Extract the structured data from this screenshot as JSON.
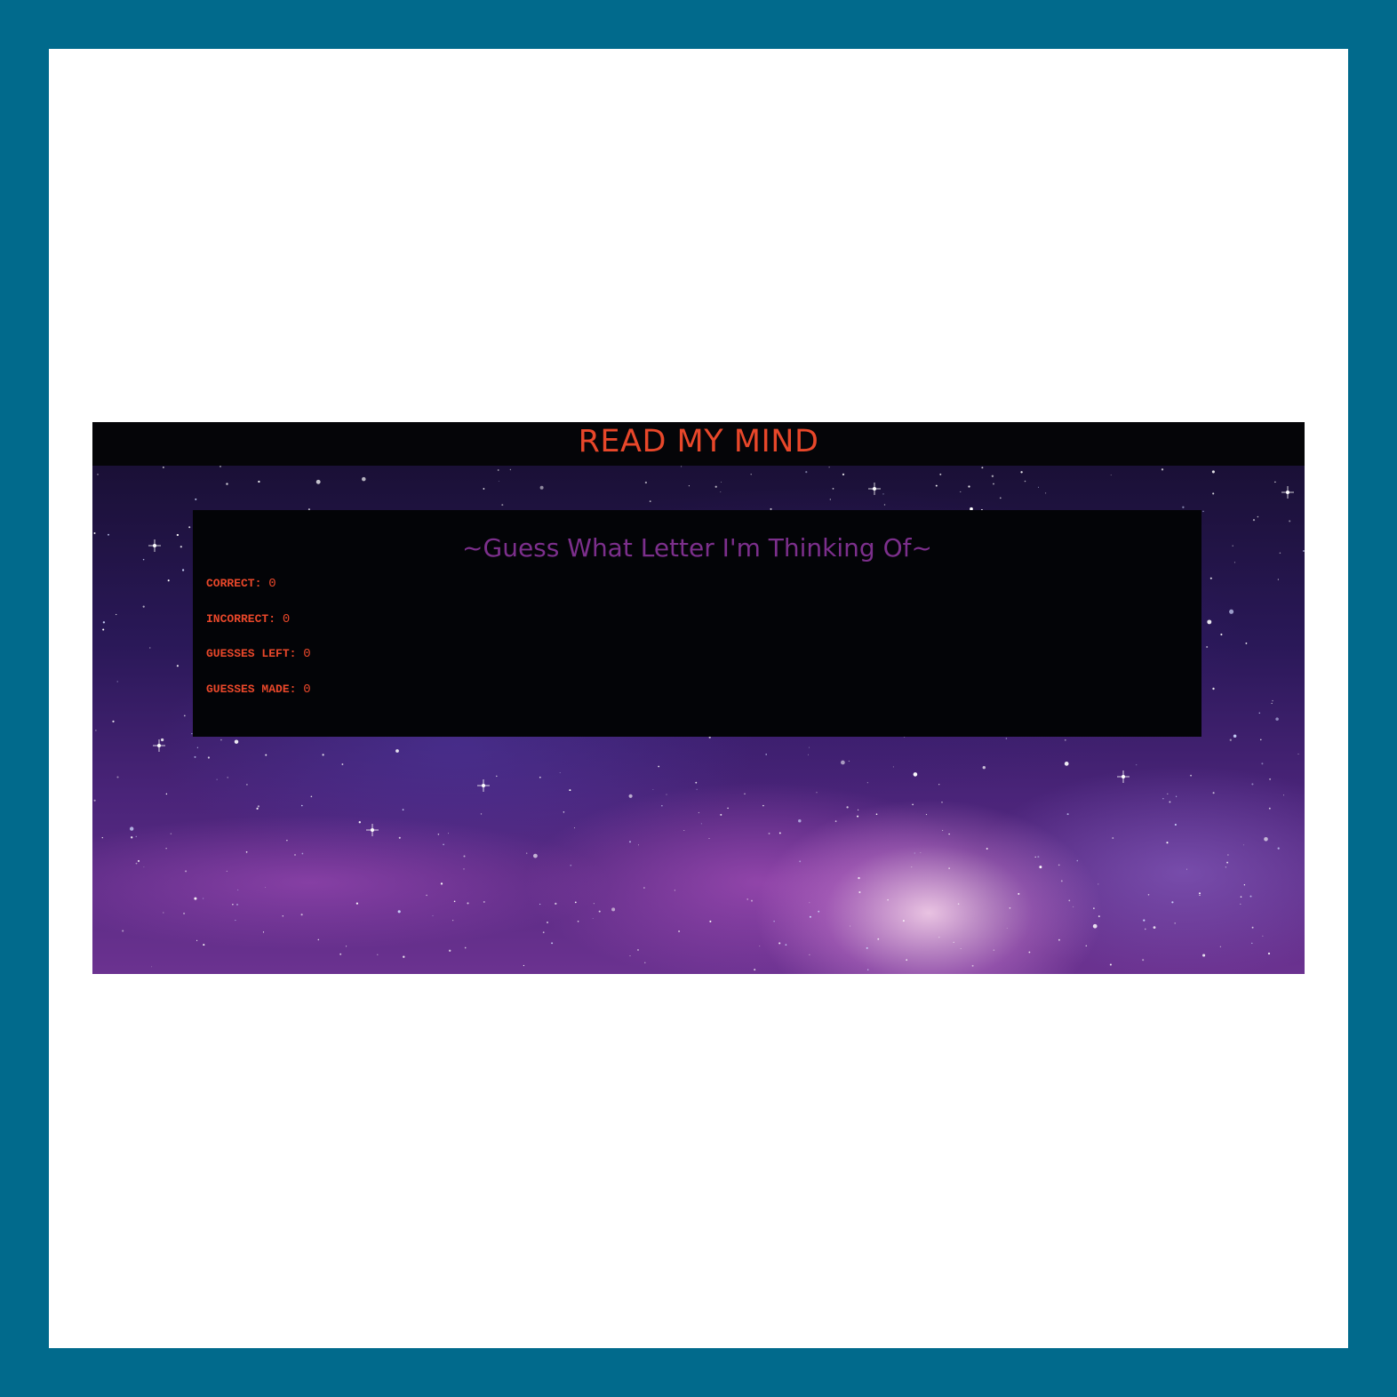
{
  "header": {
    "title": "READ MY MIND"
  },
  "game": {
    "prompt": "~Guess What Letter I'm Thinking Of~",
    "stats": [
      {
        "label": "CORRECT:",
        "value": "0"
      },
      {
        "label": "INCORRECT:",
        "value": "0"
      },
      {
        "label": "GUESSES LEFT:",
        "value": "0"
      },
      {
        "label": "GUESSES MADE:",
        "value": "0"
      }
    ]
  },
  "theme": {
    "page_border": "#016a8c",
    "header_background": "#050508",
    "title_color": "#e8472a",
    "prompt_color": "#7c2f8c",
    "stat_color": "#e8472a",
    "panel_background": "#030407"
  }
}
